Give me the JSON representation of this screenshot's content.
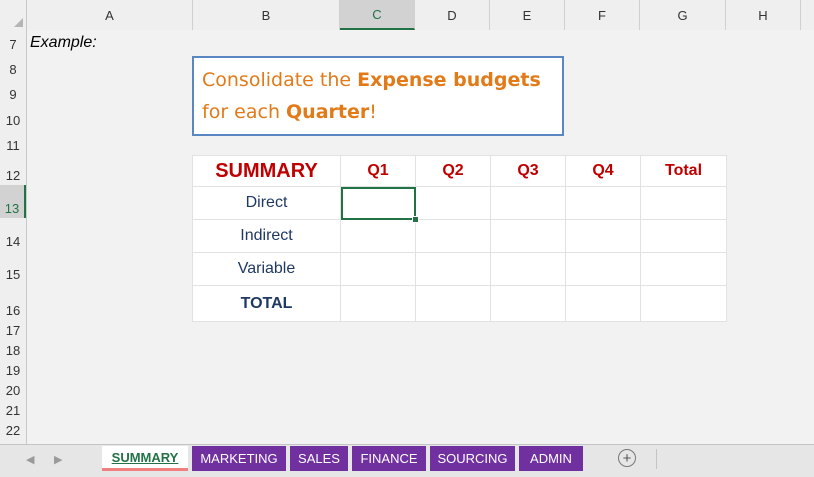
{
  "columns": [
    "A",
    "B",
    "C",
    "D",
    "E",
    "F",
    "G",
    "H"
  ],
  "rows": [
    "7",
    "8",
    "9",
    "10",
    "11",
    "12",
    "13",
    "14",
    "15",
    "16",
    "17",
    "18",
    "19",
    "20",
    "21",
    "22"
  ],
  "selected_column": "C",
  "selected_row": "13",
  "example_label": "Example:",
  "note": {
    "part1": "Consolidate the ",
    "bold1": "Expense budgets",
    "part2": " for each ",
    "bold2": "Quarter",
    "part3": "!"
  },
  "summary_table": {
    "title": "SUMMARY",
    "headers": [
      "Q1",
      "Q2",
      "Q3",
      "Q4",
      "Total"
    ],
    "row_labels": [
      "Direct",
      "Indirect",
      "Variable",
      "TOTAL"
    ]
  },
  "sheet_tabs": [
    "SUMMARY",
    "MARKETING",
    "SALES",
    "FINANCE",
    "SOURCING",
    "ADMIN"
  ],
  "active_tab": "SUMMARY",
  "nav": {
    "prev": "◀",
    "next": "▶"
  },
  "add_sheet_symbol": "+",
  "colors": {
    "accent_green": "#217346",
    "tab_purple": "#7030a0",
    "header_red": "#c00000",
    "note_orange": "#e27a18",
    "note_border": "#5a86c2"
  }
}
